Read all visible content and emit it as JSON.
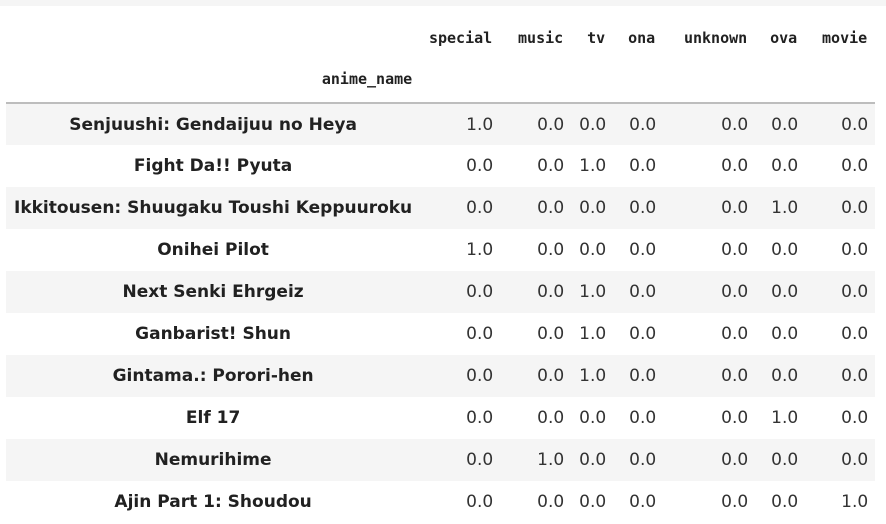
{
  "table": {
    "index_name": "anime_name",
    "columns": [
      "special",
      "music",
      "tv",
      "ona",
      "unknown",
      "ova",
      "movie"
    ],
    "rows": [
      {
        "name": "Senjuushi: Gendaijuu no Heya",
        "values": [
          "1.0",
          "0.0",
          "0.0",
          "0.0",
          "0.0",
          "0.0",
          "0.0"
        ]
      },
      {
        "name": "Fight Da!! Pyuta",
        "values": [
          "0.0",
          "0.0",
          "1.0",
          "0.0",
          "0.0",
          "0.0",
          "0.0"
        ]
      },
      {
        "name": "Ikkitousen: Shuugaku Toushi Keppuuroku",
        "values": [
          "0.0",
          "0.0",
          "0.0",
          "0.0",
          "0.0",
          "1.0",
          "0.0"
        ]
      },
      {
        "name": "Onihei Pilot",
        "values": [
          "1.0",
          "0.0",
          "0.0",
          "0.0",
          "0.0",
          "0.0",
          "0.0"
        ]
      },
      {
        "name": "Next Senki Ehrgeiz",
        "values": [
          "0.0",
          "0.0",
          "1.0",
          "0.0",
          "0.0",
          "0.0",
          "0.0"
        ]
      },
      {
        "name": "Ganbarist! Shun",
        "values": [
          "0.0",
          "0.0",
          "1.0",
          "0.0",
          "0.0",
          "0.0",
          "0.0"
        ]
      },
      {
        "name": "Gintama.: Porori-hen",
        "values": [
          "0.0",
          "0.0",
          "1.0",
          "0.0",
          "0.0",
          "0.0",
          "0.0"
        ]
      },
      {
        "name": "Elf 17",
        "values": [
          "0.0",
          "0.0",
          "0.0",
          "0.0",
          "0.0",
          "1.0",
          "0.0"
        ]
      },
      {
        "name": "Nemurihime",
        "values": [
          "0.0",
          "1.0",
          "0.0",
          "0.0",
          "0.0",
          "0.0",
          "0.0"
        ]
      },
      {
        "name": "Ajin Part 1: Shoudou",
        "values": [
          "0.0",
          "0.0",
          "0.0",
          "0.0",
          "0.0",
          "0.0",
          "1.0"
        ]
      }
    ]
  }
}
